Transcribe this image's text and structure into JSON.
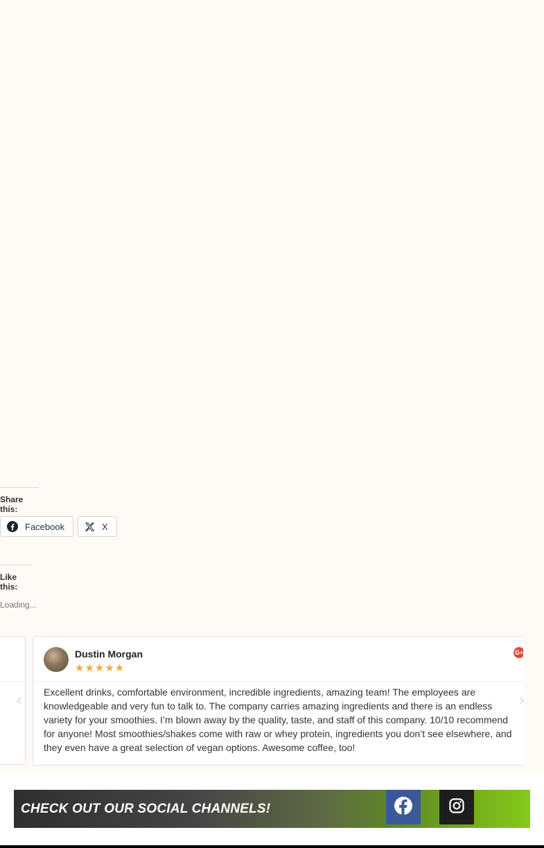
{
  "share": {
    "title": "Share this:",
    "buttons": [
      {
        "label": "Facebook",
        "icon": "facebook-icon"
      },
      {
        "label": "X",
        "icon": "x-icon"
      }
    ]
  },
  "like": {
    "title": "Like this:",
    "loading": "Loading..."
  },
  "review": {
    "reviewer": "Dustin Morgan",
    "rating": 5,
    "rating_max": 5,
    "source_icon": "google-plus-icon",
    "source_glyph": "G+",
    "text": "Excellent drinks, comfortable environment, incredible ingredients, amazing team! The employees are knowledgeable and very fun to talk to. The company carries amazing ingredients and there is an endless variety for your smoothies. I’m blown away by the quality, taste, and staff of this company. 10/10 recommend for anyone! Most smoothies/shakes come with raw or whey protein, ingredients you don’t see elsewhere, and they even have a great selection of vegan options. Awesome coffee, too!",
    "prev_arrow": "‹",
    "next_arrow": "›"
  },
  "social": {
    "heading": "CHECK OUT OUR SOCIAL CHANNELS!",
    "links": [
      {
        "icon": "facebook-icon",
        "color": "#3b5998"
      },
      {
        "icon": "instagram-icon",
        "color": "#1e1e1e"
      }
    ]
  },
  "colors": {
    "background": "#fffaf6",
    "star": "#f2a93b",
    "google_plus": "#dd4b39",
    "banner_start": "#2f2f2f",
    "banner_end": "#86c91a"
  }
}
